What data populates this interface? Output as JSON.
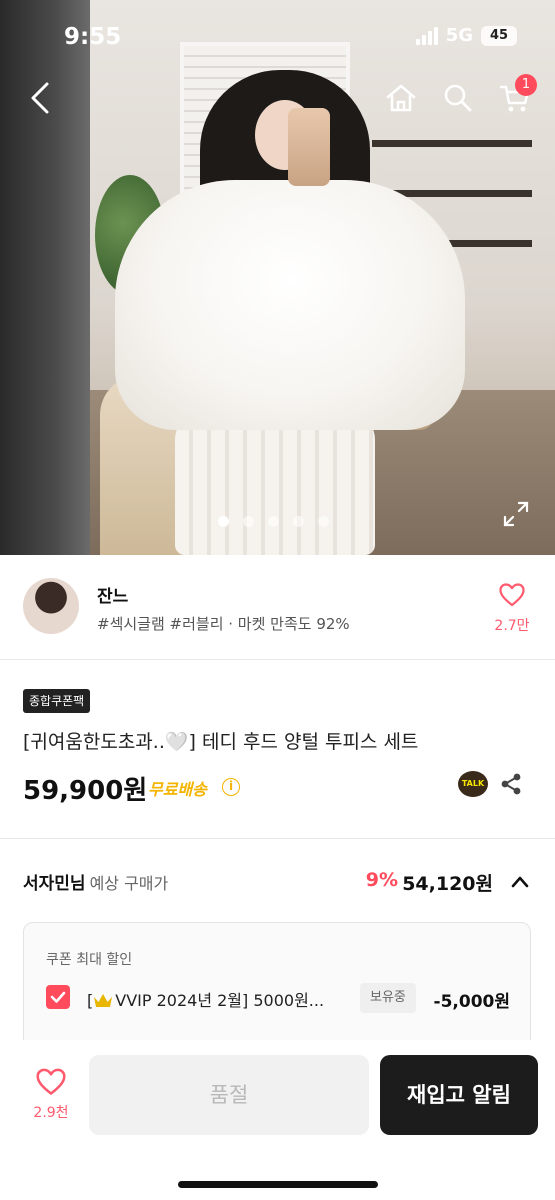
{
  "status_bar": {
    "time": "9:55",
    "network": "5G",
    "battery": "45"
  },
  "nav": {
    "cart_count": "1"
  },
  "gallery": {
    "slides": 5,
    "active_index": 0
  },
  "seller": {
    "name": "잔느",
    "tags": "#섹시글램 #러블리 · 마켓 만족도 92%",
    "likes": "2.7만"
  },
  "product": {
    "badge": "종합쿠폰팩",
    "title": "[귀여움한도초과..🤍] 테디 후드 양털 투피스 세트",
    "price": "59,900원",
    "shipping": "무료배송"
  },
  "member": {
    "name": "서자민님",
    "label": "예상 구매가",
    "discount": "9%",
    "price": "54,120원"
  },
  "coupon": {
    "header": "쿠폰 최대 할인",
    "name": "VVIP 2024년 2월] 5000원...",
    "name_prefix": "[",
    "own_label": "보유중",
    "amount": "-5,000원"
  },
  "bottom": {
    "likes": "2.9천",
    "soldout_label": "품절",
    "restock_label": "재입고 알림"
  },
  "colors": {
    "accent": "#ff4b5c",
    "shipping": "#f4b400",
    "dark_button": "#1c1c1c"
  }
}
